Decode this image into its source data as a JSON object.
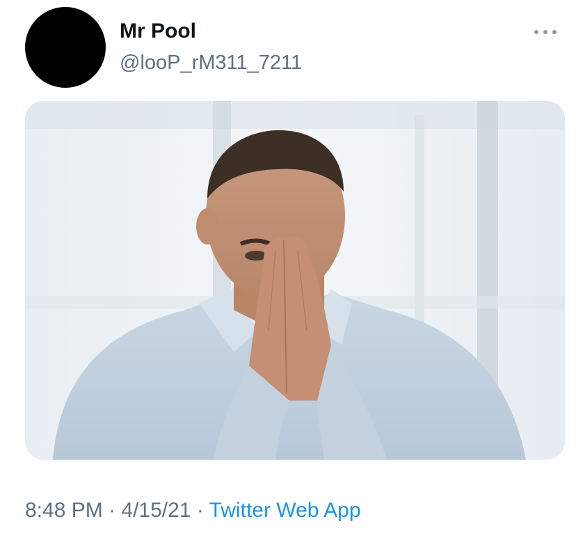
{
  "tweet": {
    "display_name": "Mr Pool",
    "handle": "@looP_rM311_7211",
    "time": "8:48 PM",
    "separator": " · ",
    "date": "4/15/21",
    "source": "Twitter Web App"
  },
  "colors": {
    "text_primary": "#0f1419",
    "text_secondary": "#5b7083",
    "link": "#1b95e0",
    "avatar": "#000000"
  },
  "icons": {
    "more": "more-options-icon"
  }
}
